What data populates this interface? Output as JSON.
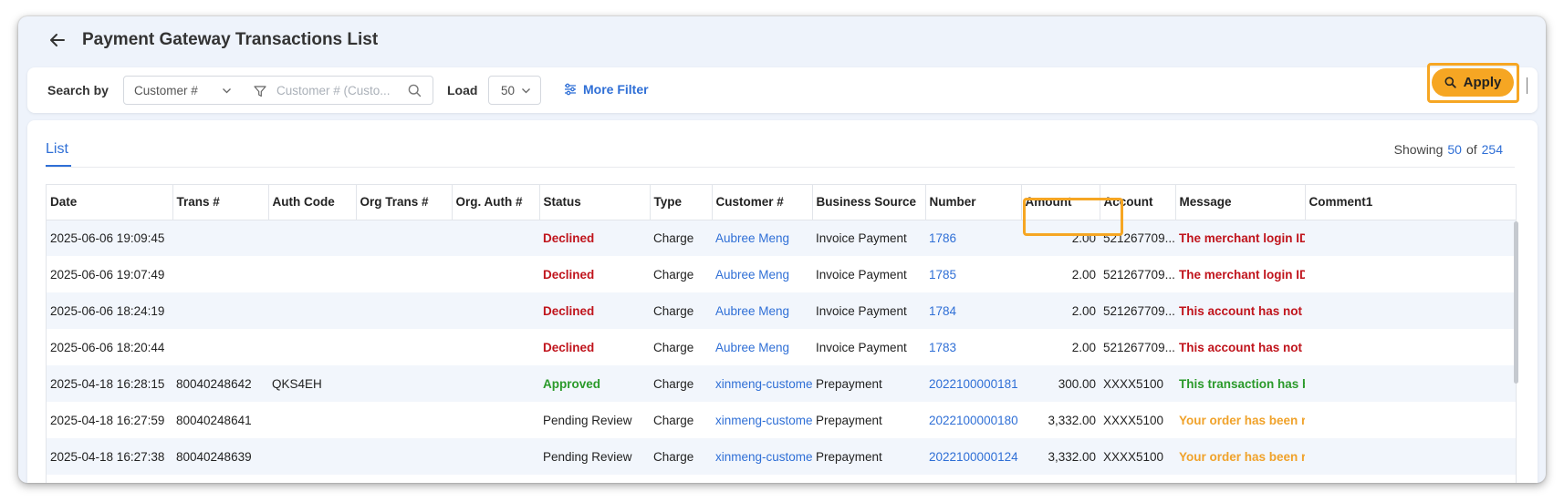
{
  "header": {
    "title": "Payment Gateway Transactions List"
  },
  "filter": {
    "search_by_label": "Search by",
    "search_by_value": "Customer #",
    "search_placeholder": "Customer # (Custo...",
    "load_label": "Load",
    "load_value": "50",
    "more_filter_label": "More Filter",
    "apply_label": "Apply"
  },
  "list": {
    "tab_label": "List",
    "showing_label": "Showing",
    "showing_count": "50",
    "of_label": "of",
    "total_count": "254"
  },
  "table": {
    "columns": [
      "Date",
      "Trans #",
      "Auth Code",
      "Org Trans #",
      "Org. Auth #",
      "Status",
      "Type",
      "Customer #",
      "Business Source",
      "Number",
      "Amount",
      "Account",
      "Message",
      "Comment1"
    ],
    "rows": [
      [
        "2025-06-06 19:09:45",
        "",
        "",
        "",
        "",
        "Declined",
        "Charge",
        "Aubree Meng",
        "Invoice Payment",
        "1786",
        "2.00",
        "521267709...",
        "The merchant login ID or password is invalid",
        ""
      ],
      [
        "2025-06-06 19:07:49",
        "",
        "",
        "",
        "",
        "Declined",
        "Charge",
        "Aubree Meng",
        "Invoice Payment",
        "1785",
        "2.00",
        "521267709...",
        "The merchant login ID or password is invalid",
        ""
      ],
      [
        "2025-06-06 18:24:19",
        "",
        "",
        "",
        "",
        "Declined",
        "Charge",
        "Aubree Meng",
        "Invoice Payment",
        "1784",
        "2.00",
        "521267709...",
        "This account has not been given permission",
        ""
      ],
      [
        "2025-06-06 18:20:44",
        "",
        "",
        "",
        "",
        "Declined",
        "Charge",
        "Aubree Meng",
        "Invoice Payment",
        "1783",
        "2.00",
        "521267709...",
        "This account has not been given permission",
        ""
      ],
      [
        "2025-04-18 16:28:15",
        "80040248642",
        "QKS4EH",
        "",
        "",
        "Approved",
        "Charge",
        "xinmeng-customer",
        "Prepayment",
        "2022100000181",
        "300.00",
        "XXXX5100",
        "This transaction has been approved",
        ""
      ],
      [
        "2025-04-18 16:27:59",
        "80040248641",
        "",
        "",
        "",
        "Pending Review",
        "Charge",
        "xinmeng-customer",
        "Prepayment",
        "2022100000180",
        "3,332.00",
        "XXXX5100",
        "Your order has been received",
        ""
      ],
      [
        "2025-04-18 16:27:38",
        "80040248639",
        "",
        "",
        "",
        "Pending Review",
        "Charge",
        "xinmeng-customer",
        "Prepayment",
        "2022100000124",
        "3,332.00",
        "XXXX5100",
        "Your order has been received",
        ""
      ]
    ]
  },
  "colors": {
    "accent": "#2f6fd6",
    "apply": "#f6a623",
    "declined": "#c0141c",
    "approved": "#2a9a2a",
    "pending_msg": "#f0a22a"
  }
}
